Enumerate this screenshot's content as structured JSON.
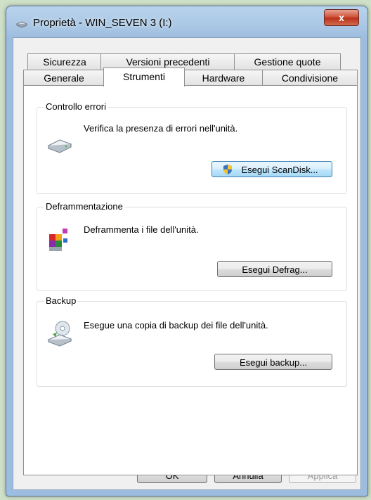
{
  "window": {
    "title": "Proprietà - WIN_SEVEN 3 (I:)",
    "close_label": "x"
  },
  "tabs": {
    "row1": [
      "Sicurezza",
      "Versioni precedenti",
      "Gestione quote"
    ],
    "row2": [
      "Generale",
      "Strumenti",
      "Hardware",
      "Condivisione"
    ],
    "active": "Strumenti"
  },
  "groups": {
    "errors": {
      "title": "Controllo errori",
      "description": "Verifica la presenza di errori nell'unità.",
      "button": "Esegui ScanDisk..."
    },
    "defrag": {
      "title": "Deframmentazione",
      "description": "Deframmenta i file dell'unità.",
      "button": "Esegui Defrag..."
    },
    "backup": {
      "title": "Backup",
      "description": "Esegue una copia di backup dei file dell'unità.",
      "button": "Esegui backup..."
    }
  },
  "footer": {
    "ok": "OK",
    "cancel": "Annulla",
    "apply": "Applica"
  },
  "icons": {
    "title": "drive-properties-icon",
    "errors": "disk-check-icon",
    "defrag": "defrag-icon",
    "backup": "backup-icon",
    "shield": "uac-shield-icon"
  },
  "colors": {
    "window_frame": "#a9c6e4",
    "close_button": "#cd4b33",
    "panel_bg": "#ffffff"
  }
}
